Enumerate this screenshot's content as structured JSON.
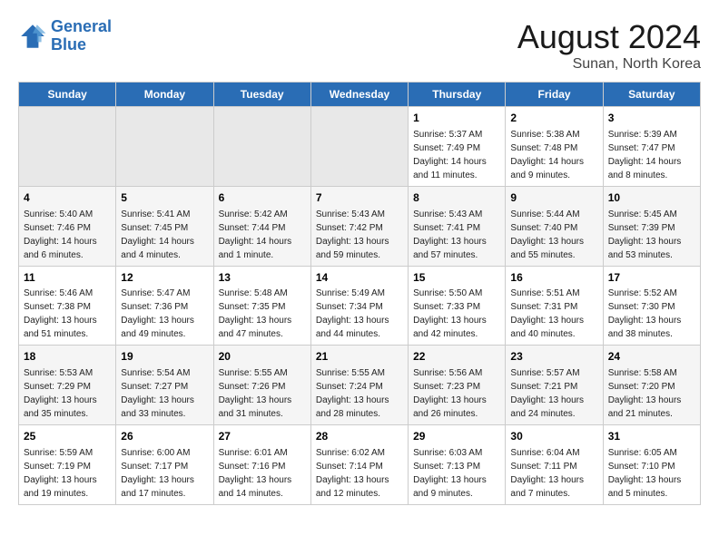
{
  "logo": {
    "line1": "General",
    "line2": "Blue"
  },
  "title": "August 2024",
  "subtitle": "Sunan, North Korea",
  "days_header": [
    "Sunday",
    "Monday",
    "Tuesday",
    "Wednesday",
    "Thursday",
    "Friday",
    "Saturday"
  ],
  "weeks": [
    [
      {
        "day": "",
        "info": ""
      },
      {
        "day": "",
        "info": ""
      },
      {
        "day": "",
        "info": ""
      },
      {
        "day": "",
        "info": ""
      },
      {
        "day": "1",
        "info": "Sunrise: 5:37 AM\nSunset: 7:49 PM\nDaylight: 14 hours\nand 11 minutes."
      },
      {
        "day": "2",
        "info": "Sunrise: 5:38 AM\nSunset: 7:48 PM\nDaylight: 14 hours\nand 9 minutes."
      },
      {
        "day": "3",
        "info": "Sunrise: 5:39 AM\nSunset: 7:47 PM\nDaylight: 14 hours\nand 8 minutes."
      }
    ],
    [
      {
        "day": "4",
        "info": "Sunrise: 5:40 AM\nSunset: 7:46 PM\nDaylight: 14 hours\nand 6 minutes."
      },
      {
        "day": "5",
        "info": "Sunrise: 5:41 AM\nSunset: 7:45 PM\nDaylight: 14 hours\nand 4 minutes."
      },
      {
        "day": "6",
        "info": "Sunrise: 5:42 AM\nSunset: 7:44 PM\nDaylight: 14 hours\nand 1 minute."
      },
      {
        "day": "7",
        "info": "Sunrise: 5:43 AM\nSunset: 7:42 PM\nDaylight: 13 hours\nand 59 minutes."
      },
      {
        "day": "8",
        "info": "Sunrise: 5:43 AM\nSunset: 7:41 PM\nDaylight: 13 hours\nand 57 minutes."
      },
      {
        "day": "9",
        "info": "Sunrise: 5:44 AM\nSunset: 7:40 PM\nDaylight: 13 hours\nand 55 minutes."
      },
      {
        "day": "10",
        "info": "Sunrise: 5:45 AM\nSunset: 7:39 PM\nDaylight: 13 hours\nand 53 minutes."
      }
    ],
    [
      {
        "day": "11",
        "info": "Sunrise: 5:46 AM\nSunset: 7:38 PM\nDaylight: 13 hours\nand 51 minutes."
      },
      {
        "day": "12",
        "info": "Sunrise: 5:47 AM\nSunset: 7:36 PM\nDaylight: 13 hours\nand 49 minutes."
      },
      {
        "day": "13",
        "info": "Sunrise: 5:48 AM\nSunset: 7:35 PM\nDaylight: 13 hours\nand 47 minutes."
      },
      {
        "day": "14",
        "info": "Sunrise: 5:49 AM\nSunset: 7:34 PM\nDaylight: 13 hours\nand 44 minutes."
      },
      {
        "day": "15",
        "info": "Sunrise: 5:50 AM\nSunset: 7:33 PM\nDaylight: 13 hours\nand 42 minutes."
      },
      {
        "day": "16",
        "info": "Sunrise: 5:51 AM\nSunset: 7:31 PM\nDaylight: 13 hours\nand 40 minutes."
      },
      {
        "day": "17",
        "info": "Sunrise: 5:52 AM\nSunset: 7:30 PM\nDaylight: 13 hours\nand 38 minutes."
      }
    ],
    [
      {
        "day": "18",
        "info": "Sunrise: 5:53 AM\nSunset: 7:29 PM\nDaylight: 13 hours\nand 35 minutes."
      },
      {
        "day": "19",
        "info": "Sunrise: 5:54 AM\nSunset: 7:27 PM\nDaylight: 13 hours\nand 33 minutes."
      },
      {
        "day": "20",
        "info": "Sunrise: 5:55 AM\nSunset: 7:26 PM\nDaylight: 13 hours\nand 31 minutes."
      },
      {
        "day": "21",
        "info": "Sunrise: 5:55 AM\nSunset: 7:24 PM\nDaylight: 13 hours\nand 28 minutes."
      },
      {
        "day": "22",
        "info": "Sunrise: 5:56 AM\nSunset: 7:23 PM\nDaylight: 13 hours\nand 26 minutes."
      },
      {
        "day": "23",
        "info": "Sunrise: 5:57 AM\nSunset: 7:21 PM\nDaylight: 13 hours\nand 24 minutes."
      },
      {
        "day": "24",
        "info": "Sunrise: 5:58 AM\nSunset: 7:20 PM\nDaylight: 13 hours\nand 21 minutes."
      }
    ],
    [
      {
        "day": "25",
        "info": "Sunrise: 5:59 AM\nSunset: 7:19 PM\nDaylight: 13 hours\nand 19 minutes."
      },
      {
        "day": "26",
        "info": "Sunrise: 6:00 AM\nSunset: 7:17 PM\nDaylight: 13 hours\nand 17 minutes."
      },
      {
        "day": "27",
        "info": "Sunrise: 6:01 AM\nSunset: 7:16 PM\nDaylight: 13 hours\nand 14 minutes."
      },
      {
        "day": "28",
        "info": "Sunrise: 6:02 AM\nSunset: 7:14 PM\nDaylight: 13 hours\nand 12 minutes."
      },
      {
        "day": "29",
        "info": "Sunrise: 6:03 AM\nSunset: 7:13 PM\nDaylight: 13 hours\nand 9 minutes."
      },
      {
        "day": "30",
        "info": "Sunrise: 6:04 AM\nSunset: 7:11 PM\nDaylight: 13 hours\nand 7 minutes."
      },
      {
        "day": "31",
        "info": "Sunrise: 6:05 AM\nSunset: 7:10 PM\nDaylight: 13 hours\nand 5 minutes."
      }
    ]
  ]
}
